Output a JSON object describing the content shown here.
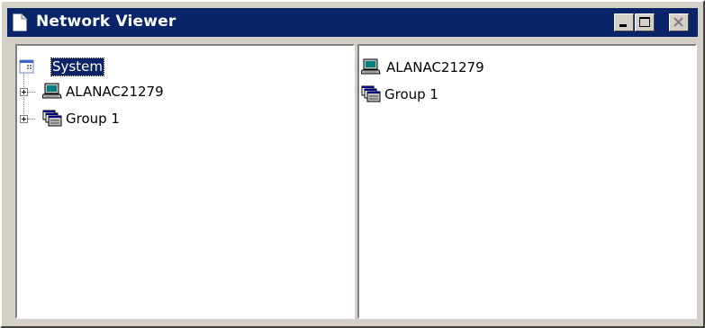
{
  "window": {
    "title": "Network Viewer",
    "title_icon": "document-icon",
    "buttons": [
      "minimize-icon",
      "maximize-icon",
      "close-icon"
    ]
  },
  "tree": {
    "root": {
      "label": "System",
      "icon": "system-icon",
      "selected": true
    },
    "children": [
      {
        "label": "ALANAC21279",
        "icon": "computer-icon",
        "expanded": false
      },
      {
        "label": "Group 1",
        "icon": "group-icon",
        "expanded": false
      }
    ]
  },
  "list": {
    "items": [
      {
        "label": "ALANAC21279",
        "icon": "computer-icon"
      },
      {
        "label": "Group 1",
        "icon": "group-icon"
      }
    ]
  },
  "colors": {
    "titlebar": "#0a246a",
    "face": "#d4d0c8",
    "selection": "#0a246a"
  }
}
